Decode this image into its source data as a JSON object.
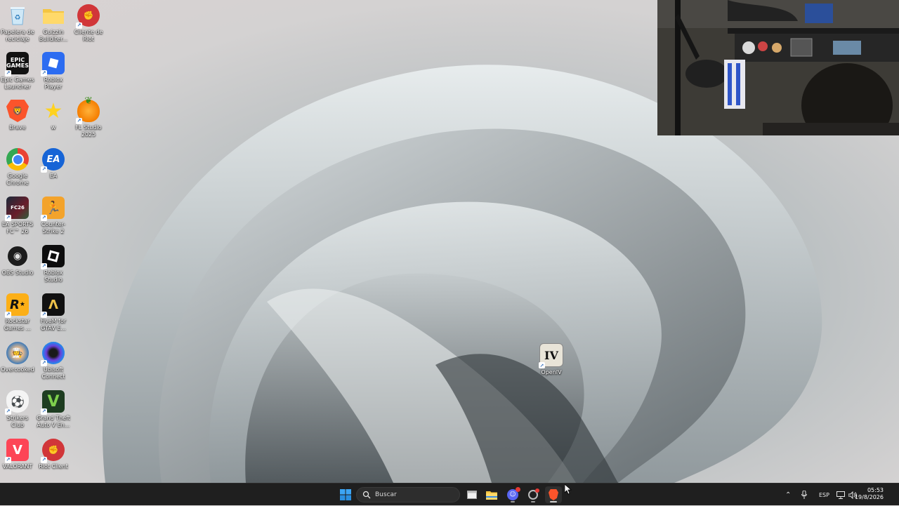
{
  "desktop": {
    "icons": [
      {
        "label": "Papelera de reciclaje",
        "icon": "recycle-bin-icon"
      },
      {
        "label": "Guizzin Bullditer...",
        "icon": "folder-icon"
      },
      {
        "label": "Cliente de Riot",
        "icon": "riot-client-icon"
      },
      {
        "label": "Epic Games Launcher",
        "icon": "epic-games-icon"
      },
      {
        "label": "Roblox Player",
        "icon": "roblox-player-icon"
      },
      {
        "label": "Brave",
        "icon": "brave-icon"
      },
      {
        "label": "w",
        "icon": "star-icon"
      },
      {
        "label": "FL Studio 2025",
        "icon": "fl-studio-icon"
      },
      {
        "label": "Google Chrome",
        "icon": "chrome-icon"
      },
      {
        "label": "EA",
        "icon": "ea-icon"
      },
      {
        "label": "EA SPORTS FC™ 26",
        "icon": "ea-fc-icon"
      },
      {
        "label": "Counter-Strike 2",
        "icon": "counter-strike-icon"
      },
      {
        "label": "OBS Studio",
        "icon": "obs-icon"
      },
      {
        "label": "Roblox Studio",
        "icon": "roblox-studio-icon"
      },
      {
        "label": "Rockstar Games ...",
        "icon": "rockstar-icon"
      },
      {
        "label": "FiveM for GTAV E...",
        "icon": "fivem-icon"
      },
      {
        "label": "Overcooked",
        "icon": "overcooked-icon"
      },
      {
        "label": "Ubisoft Connect",
        "icon": "ubisoft-icon"
      },
      {
        "label": "Strikers Club",
        "icon": "strikers-club-icon"
      },
      {
        "label": "Grand Theft Auto V En...",
        "icon": "gta-v-icon"
      },
      {
        "label": "VALORANT",
        "icon": "valorant-icon"
      },
      {
        "label": "Riot Client",
        "icon": "riot-client-icon"
      },
      {
        "label": "OpenIV",
        "icon": "openiv-icon"
      }
    ]
  },
  "taskbar": {
    "search_placeholder": "Buscar",
    "language": "ESP",
    "time": "05:53",
    "date": "19/8/2026"
  }
}
